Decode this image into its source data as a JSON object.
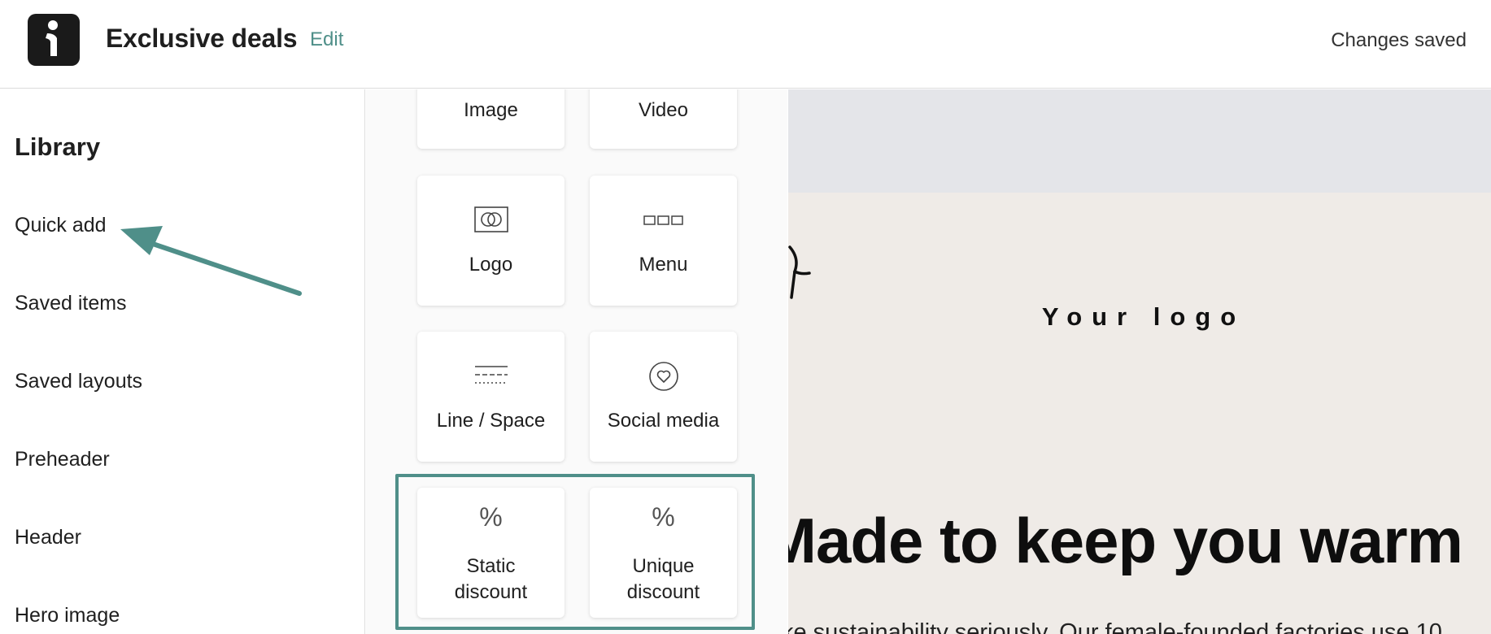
{
  "header": {
    "title": "Exclusive deals",
    "edit_label": "Edit",
    "status": "Changes saved"
  },
  "sidebar": {
    "title": "Library",
    "items": [
      {
        "label": "Quick add"
      },
      {
        "label": "Saved items"
      },
      {
        "label": "Saved layouts"
      },
      {
        "label": "Preheader"
      },
      {
        "label": "Header"
      },
      {
        "label": "Hero image"
      }
    ]
  },
  "blocks": {
    "image": "Image",
    "video": "Video",
    "logo": "Logo",
    "menu": "Menu",
    "line_space": "Line / Space",
    "social_media": "Social media",
    "static_discount_1": "Static",
    "static_discount_2": "discount",
    "unique_discount_1": "Unique",
    "unique_discount_2": "discount",
    "percent_glyph": "%"
  },
  "preview": {
    "logo_text": "Your logo",
    "headline": "Made to keep you warm",
    "body": "ke sustainability seriously. Our female-founded factories use 10"
  },
  "colors": {
    "accent": "#4f8f89",
    "preview_bg": "#efebe7",
    "preview_band": "#e4e5e9"
  },
  "icons": {
    "app_logo": "info-person-icon",
    "logo_block": "logo-block-icon",
    "menu_block": "menu-block-icon",
    "line_block": "line-space-icon",
    "social_block": "heart-circle-icon"
  }
}
